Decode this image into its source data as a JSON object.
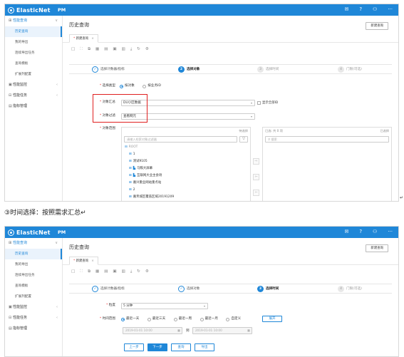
{
  "app": {
    "logo": "ElasticNet",
    "module": "PM",
    "top_icons": [
      "mail-icon",
      "help-icon",
      "user-icon",
      "more-icon"
    ]
  },
  "top_icon_glyphs": [
    "✉",
    "?",
    "⚇",
    "···"
  ],
  "sidebar": {
    "groups": [
      {
        "label": "性能查询",
        "chev": "∨",
        "items": [
          "历史查询",
          "我的导出",
          "连续导出任务",
          "查询模板",
          "扩展列配置"
        ]
      },
      {
        "label": "性能监控",
        "chev": "‹"
      },
      {
        "label": "性能任务",
        "chev": "‹"
      },
      {
        "label": "指标管理",
        "chev": ""
      }
    ]
  },
  "page": {
    "title": "历史查询",
    "new_button": "新建查询"
  },
  "tab": {
    "label": "新建查询",
    "close": "×",
    "dot": "*"
  },
  "toolbar_icons": [
    "□",
    "⛶",
    "⧉",
    "▦",
    "▤",
    "▣",
    "▥",
    "⤓",
    "↻",
    "⚙"
  ],
  "steps": [
    {
      "num": "✓",
      "label": "选择计数器/指标",
      "state": "done"
    },
    {
      "num": "2",
      "label": "选择对象",
      "state": "current"
    },
    {
      "num": "3",
      "label": "选择时间",
      "state": "todo"
    },
    {
      "num": "4",
      "label": "门限(可选)",
      "state": "todo"
    }
  ],
  "steps2": [
    {
      "num": "✓",
      "label": "选择计数器/指标",
      "state": "done"
    },
    {
      "num": "✓",
      "label": "选择对象",
      "state": "done"
    },
    {
      "num": "3",
      "label": "选择时间",
      "state": "current"
    },
    {
      "num": "4",
      "label": "门限(可选)",
      "state": "todo"
    }
  ],
  "form1": {
    "select_type_label": "选择类型",
    "select_type_options": [
      "按对象",
      "按业务ID"
    ],
    "agg_label": "对象汇总",
    "agg_value": "DU小区数据",
    "show_id_label": "显示全部ID",
    "filter_label": "对象过滤",
    "filter_value": "查看网元",
    "range_label": "对象范围",
    "left_panel_head": "待选择",
    "right_panel_head_left": "已选: 共 0 项",
    "right_panel_head_right": "已选择",
    "left_search_placeholder": "请输入检索对象过滤器",
    "right_search_placeholder": "搜索",
    "filter_btn": "▽",
    "transfer_arrows": [
      "⇨",
      "⇦",
      "⇦"
    ],
    "tree": [
      {
        "pref": "⊟",
        "label": "ROOT",
        "indent": 0
      },
      {
        "pref": "⊞",
        "label": "1",
        "indent": 1
      },
      {
        "pref": "⊞",
        "label": "测试9105",
        "indent": 1
      },
      {
        "pref": "⊞",
        "label": "马鞍大屏幕",
        "indent": 1,
        "icon": "bar"
      },
      {
        "pref": "⊞",
        "label": "互联网大业主会场",
        "indent": 1,
        "icon": "bar"
      },
      {
        "pref": "⊞",
        "label": "嘉兴重业网站重点站",
        "indent": 1
      },
      {
        "pref": "⊞",
        "label": "2",
        "indent": 1
      },
      {
        "pref": "⊞",
        "label": "嘉禾城区覆盖区域20191209",
        "indent": 1
      }
    ]
  },
  "caption": "③时间选择：按照需求汇总↵",
  "return_mark": "↵",
  "form2": {
    "granularity_label": "粒度",
    "granularity_value": "5 分钟",
    "time_range_label": "时间范围",
    "time_options": [
      "最近一天",
      "最近三天",
      "最近一周",
      "最近一月",
      "自定义"
    ],
    "open_button": "展开",
    "start_date": "2019-01-01 10:00",
    "end_date": "2019-01-01 10:00",
    "date_sep": "到",
    "cal_icon": "▦",
    "buttons": [
      "上一步",
      "下一步",
      "查询",
      "导出"
    ]
  }
}
